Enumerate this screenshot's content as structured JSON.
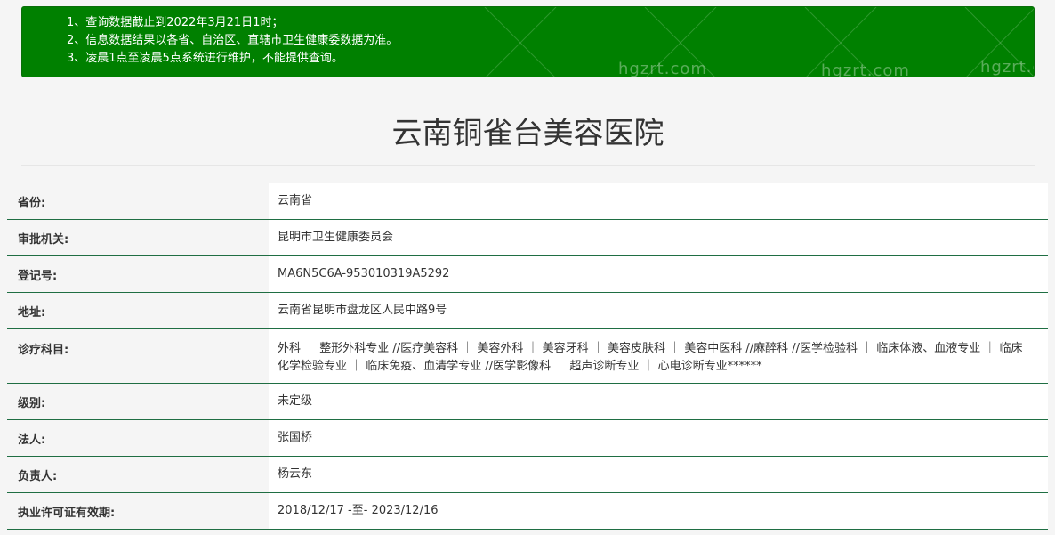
{
  "notice": {
    "lines": [
      "1、查询数据截止到2022年3月21日1时；",
      "2、信息数据结果以各省、自治区、直辖市卫生健康委数据为准。",
      "3、凌晨1点至凌晨5点系统进行维护，不能提供查询。"
    ],
    "watermarks": [
      "hgzrt.com",
      "hgzrt.com",
      "hgzrt.c"
    ],
    "bg_color": "#008000"
  },
  "page_title": "云南铜雀台美容医院",
  "fields": [
    {
      "label": "省份:",
      "value": "云南省"
    },
    {
      "label": "审批机关:",
      "value": "昆明市卫生健康委员会"
    },
    {
      "label": "登记号:",
      "value": "MA6N5C6A-953010319A5292"
    },
    {
      "label": "地址:",
      "value": "云南省昆明市盘龙区人民中路9号"
    },
    {
      "label": "诊疗科目:",
      "value": "外科 ｜ 整形外科专业 //医疗美容科 ｜ 美容外科 ｜ 美容牙科 ｜ 美容皮肤科 ｜ 美容中医科 //麻醉科 //医学检验科 ｜ 临床体液、血液专业 ｜ 临床化学检验专业 ｜ 临床免疫、血清学专业 //医学影像科 ｜ 超声诊断专业 ｜ 心电诊断专业******"
    },
    {
      "label": "级别:",
      "value": "未定级"
    },
    {
      "label": "法人:",
      "value": "张国桥"
    },
    {
      "label": "负责人:",
      "value": "杨云东"
    },
    {
      "label": "执业许可证有效期:",
      "value": "2018/12/17 -至- 2023/12/16"
    }
  ]
}
